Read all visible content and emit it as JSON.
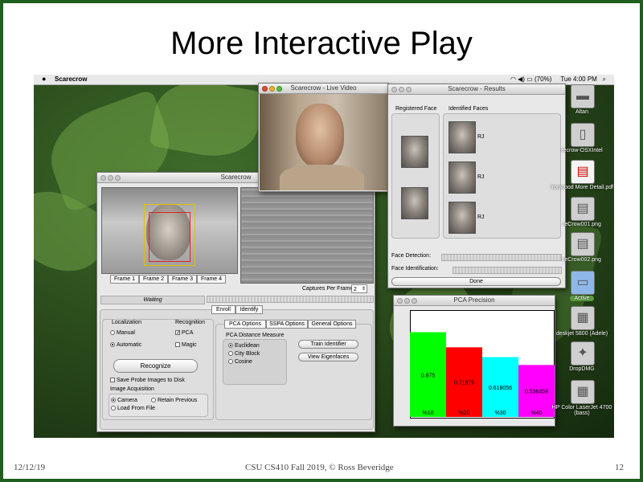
{
  "slide": {
    "title": "More Interactive Play",
    "footer_date": "12/12/19",
    "footer_center": "CSU CS410 Fall 2019, © Ross Beveridge",
    "footer_page": "12"
  },
  "menubar": {
    "apple": "",
    "app": "Scarecrow",
    "battery": "(70%)",
    "clock": "Tue 4:00 PM"
  },
  "live_video": {
    "title": "Scarecrow - Live Video"
  },
  "results": {
    "title": "Scarecrow - Results",
    "registered_header": "Registered Face",
    "identified_header": "Identified Faces",
    "id_labels": [
      "RJ",
      "RJ",
      "RJ"
    ],
    "face_detection_label": "Face Detection:",
    "face_identification_label": "Face Identification:",
    "done_label": "Done"
  },
  "main": {
    "title": "Scarecrow",
    "frames": [
      "Frame 1",
      "Frame 2",
      "Frame 3",
      "Frame 4"
    ],
    "captures_label": "Captures Per Frame",
    "captures_value": "2",
    "waiting": "Waiting",
    "tabs": [
      "Enroll",
      "Identify"
    ],
    "localization_header": "Localization",
    "localization_options": [
      "Manual",
      "Automatic"
    ],
    "recognition_header": "Recognition",
    "recognition_options": [
      "PCA",
      "Magic"
    ],
    "recognize_label": "Recognize",
    "save_probe_label": "Save Probe Images to Disk",
    "acquisition_header": "Image Acquisition",
    "acquisition_options": [
      "Camera",
      "Retain Previous",
      "Load From File"
    ],
    "option_tabs": [
      "PCA Options",
      "SSPA Options",
      "General Options"
    ],
    "distance_header": "PCA Distance Measure",
    "distance_options": [
      "Euclidean",
      "City Block",
      "Cosine"
    ],
    "train_label": "Train Identifier",
    "view_eigen_label": "View Eigenfaces"
  },
  "precision_window": {
    "title": "PCA Precision"
  },
  "chart_data": {
    "type": "bar",
    "categories": [
      "%10",
      "%20",
      "%30",
      "%40"
    ],
    "values": [
      0.875,
      0.71875,
      0.618056,
      0.536458
    ],
    "value_labels": [
      "0.875",
      "0.71875",
      "0.618056",
      "0.536458"
    ],
    "colors": [
      "#00ff00",
      "#ff0000",
      "#00ffff",
      "#ff00ff"
    ],
    "ylim": [
      0,
      1
    ]
  },
  "desktop_icons": [
    {
      "name": "hard-drive-icon",
      "label": "Altan"
    },
    {
      "name": "disk-image-icon",
      "label": "recrow-OSXIntel"
    },
    {
      "name": "pdf-icon",
      "label": "Ironwood More Detail.pdf"
    },
    {
      "name": "png-file-icon",
      "label": "reCrow001.png"
    },
    {
      "name": "png-file-icon",
      "label": "reCrow002.png"
    },
    {
      "name": "folder-icon",
      "label": "Active"
    },
    {
      "name": "printer-icon",
      "label": "deskjet 5800 (Adele)"
    },
    {
      "name": "dropdmg-icon",
      "label": "DropDMG"
    },
    {
      "name": "laser-printer-icon",
      "label": "HP Color LaserJet 4700 (bass)"
    }
  ]
}
